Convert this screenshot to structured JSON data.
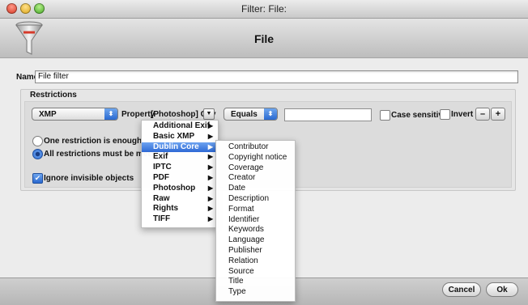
{
  "window": {
    "title": "Filter: File:"
  },
  "header": {
    "title": "File",
    "icon": "funnel-icon"
  },
  "name": {
    "label": "Name",
    "value": "File filter"
  },
  "restrictions": {
    "title": "Restrictions",
    "schema_select": "XMP",
    "property_label": "Property",
    "property_value": "[Photoshop] City",
    "operator_select": "Equals",
    "value_field": "",
    "case_sensitive_label": "Case sensitive",
    "invert_label": "Invert",
    "remove_label": "–",
    "add_label": "+",
    "option_any": "One restriction is enough to pass",
    "option_all": "All restrictions must be met",
    "ignore_invisible_label": "Ignore invisible objects"
  },
  "menu": {
    "items": [
      {
        "label": "Additional Exif",
        "arrow": "▶"
      },
      {
        "label": "Basic XMP",
        "arrow": "▶"
      },
      {
        "label": "Dublin Core",
        "arrow": "▶"
      },
      {
        "label": "Exif",
        "arrow": "▶"
      },
      {
        "label": "IPTC",
        "arrow": "▶"
      },
      {
        "label": "PDF",
        "arrow": "▶"
      },
      {
        "label": "Photoshop",
        "arrow": "▶"
      },
      {
        "label": "Raw",
        "arrow": "▶"
      },
      {
        "label": "Rights",
        "arrow": "▶"
      },
      {
        "label": "TIFF",
        "arrow": "▶"
      }
    ],
    "selected_index": 2
  },
  "submenu": {
    "items": [
      "Contributor",
      "Copyright notice",
      "Coverage",
      "Creator",
      "Date",
      "Description",
      "Format",
      "Identifier",
      "Keywords",
      "Language",
      "Publisher",
      "Relation",
      "Source",
      "Title",
      "Type"
    ]
  },
  "footer": {
    "cancel_label": "Cancel",
    "ok_label": "Ok"
  },
  "colors": {
    "selection": "#2d69d5",
    "accent": "#3a78dc"
  }
}
